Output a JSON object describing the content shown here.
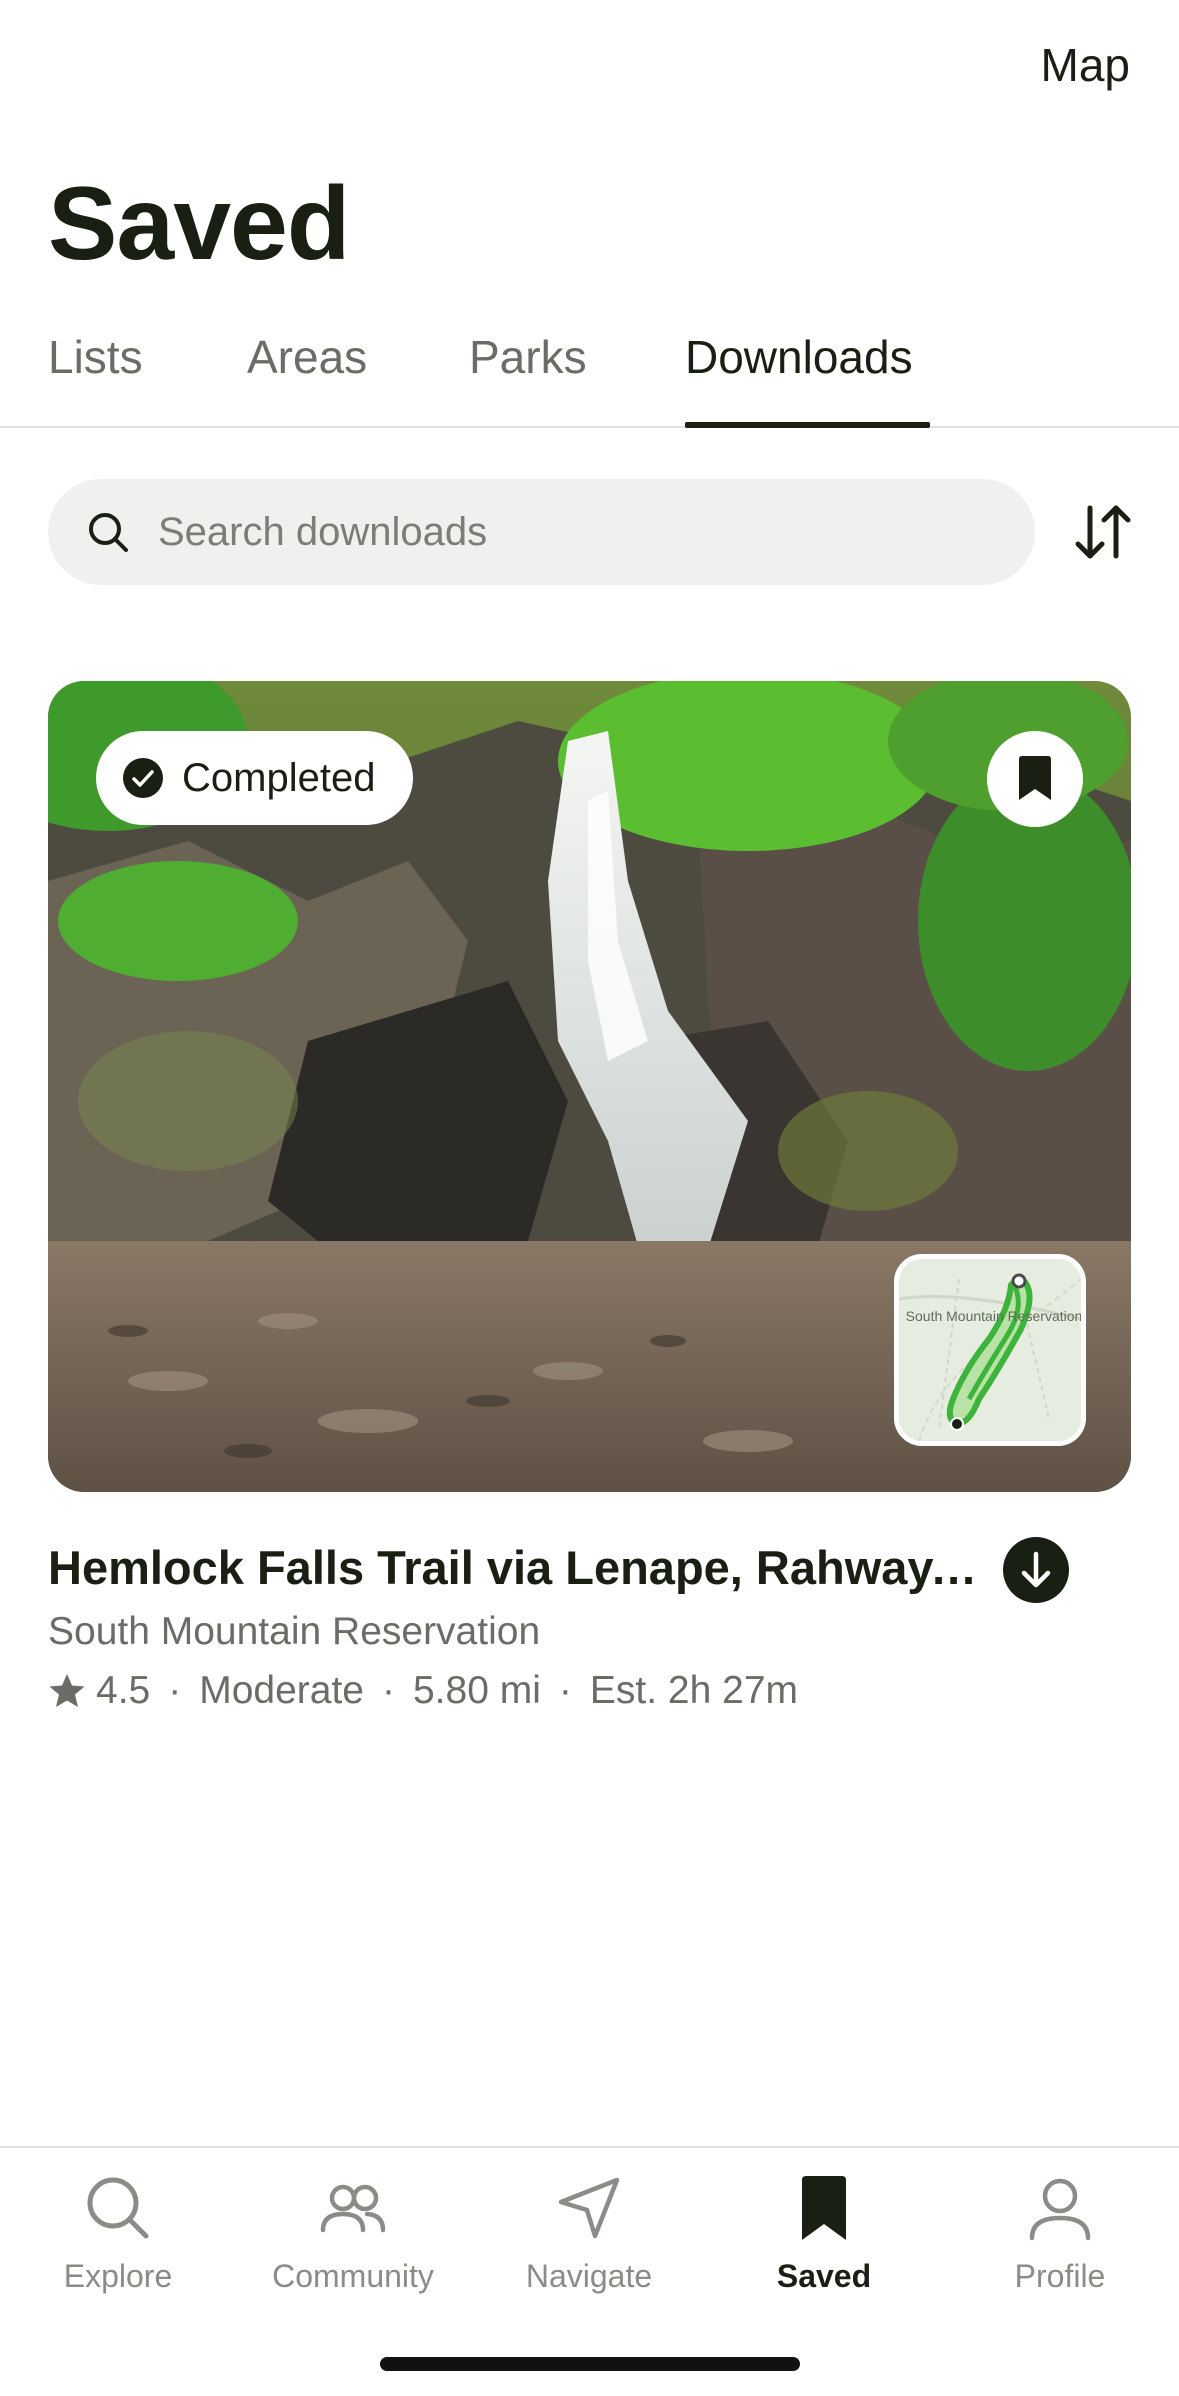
{
  "header": {
    "map_label": "Map",
    "title": "Saved"
  },
  "tabs": [
    {
      "label": "Lists",
      "active": false
    },
    {
      "label": "Areas",
      "active": false
    },
    {
      "label": "Parks",
      "active": false
    },
    {
      "label": "Downloads",
      "active": true
    }
  ],
  "search": {
    "placeholder": "Search downloads",
    "icon": "search-icon",
    "sort_icon": "sort-arrows-icon"
  },
  "trail_card": {
    "badge_label": "Completed",
    "badge_icon": "check-circle-icon",
    "bookmark_icon": "bookmark-icon",
    "title": "Hemlock Falls Trail via Lenape, Rahway, a...",
    "area": "South Mountain Reservation",
    "rating": "4.5",
    "difficulty": "Moderate",
    "distance": "5.80 mi",
    "est_time": "Est. 2h 27m",
    "separator": "·",
    "download_icon": "download-icon",
    "map_label": "South Mountain Reservation"
  },
  "bottom_nav": [
    {
      "label": "Explore",
      "icon": "search-icon",
      "active": false
    },
    {
      "label": "Community",
      "icon": "people-icon",
      "active": false
    },
    {
      "label": "Navigate",
      "icon": "navigate-arrow-icon",
      "active": false
    },
    {
      "label": "Saved",
      "icon": "bookmark-icon",
      "active": true
    },
    {
      "label": "Profile",
      "icon": "person-icon",
      "active": false
    }
  ],
  "colors": {
    "text_primary": "#1a1f14",
    "text_secondary": "#6a6c66",
    "search_bg": "#f0f1ee",
    "trail_green": "#3cb43c"
  }
}
